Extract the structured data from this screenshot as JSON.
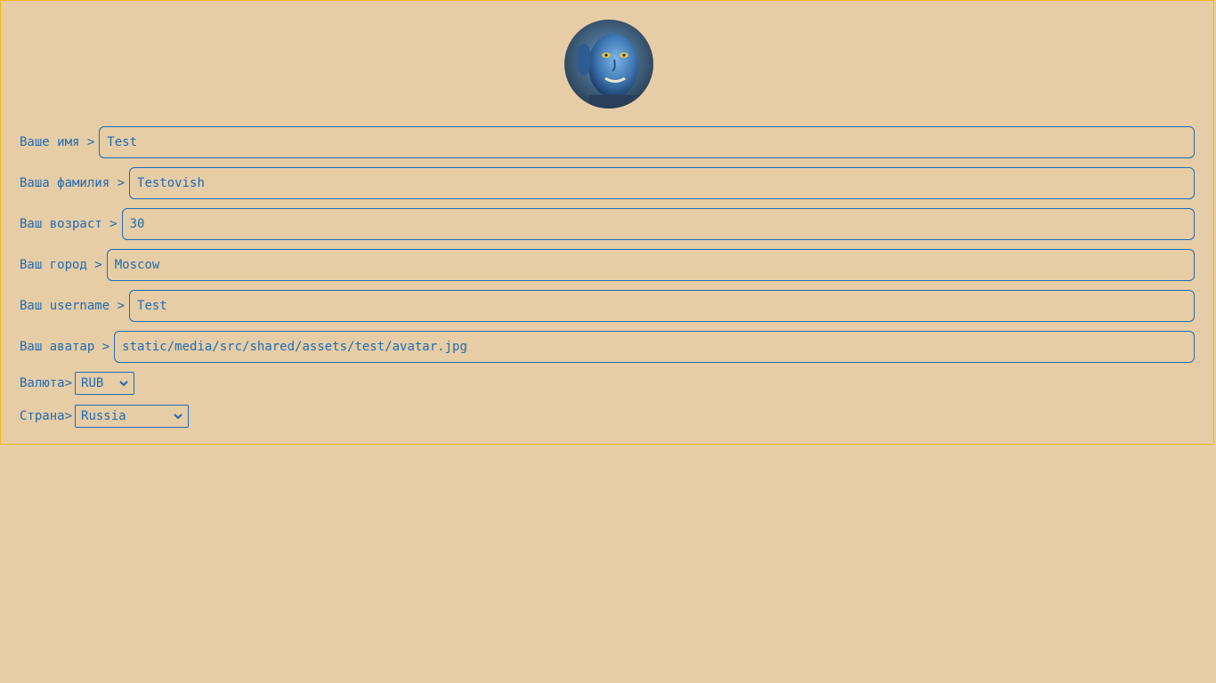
{
  "profile": {
    "avatar_alt": "avatar",
    "fields": [
      {
        "label": "Ваше имя >",
        "value": "Test"
      },
      {
        "label": "Ваша фамилия >",
        "value": "Testovish"
      },
      {
        "label": "Ваш возраст >",
        "value": "30"
      },
      {
        "label": "Ваш город >",
        "value": "Moscow"
      },
      {
        "label": "Ваш username >",
        "value": "Test"
      },
      {
        "label": "Ваш аватар >",
        "value": "static/media/src/shared/assets/test/avatar.jpg"
      }
    ],
    "currency": {
      "label": "Валюта>",
      "value": "RUB"
    },
    "country": {
      "label": "Страна>",
      "value": "Russia"
    }
  },
  "colors": {
    "background": "#e6cda6",
    "accent": "#1f6bb3",
    "card_border": "#f0b81e"
  }
}
